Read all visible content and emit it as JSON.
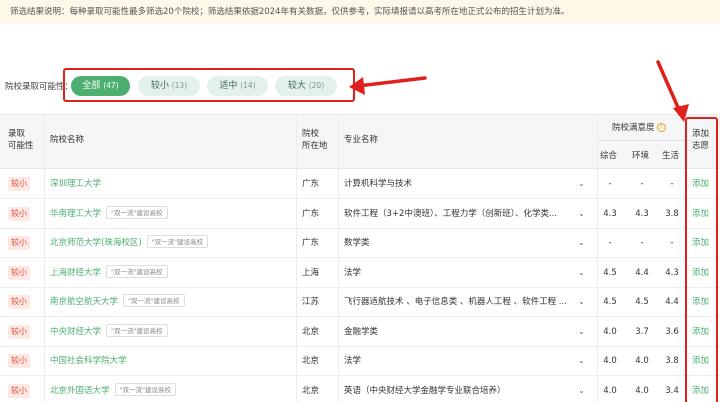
{
  "notice": "筛选结果说明：每种录取可能性最多筛选20个院校；筛选结果依据2024年有关数据，仅供参考，实际填报请以高考所在地正式公布的招生计划为准。",
  "filter": {
    "label": "院校录取可能性：",
    "pills": [
      {
        "label": "全部",
        "count": "(47)"
      },
      {
        "label": "较小",
        "count": "(13)"
      },
      {
        "label": "适中",
        "count": "(14)"
      },
      {
        "label": "较大",
        "count": "(20)"
      }
    ]
  },
  "table": {
    "headers": {
      "possibility_line1": "录取",
      "possibility_line2": "可能性",
      "school": "院校名称",
      "location_line1": "院校",
      "location_line2": "所在地",
      "major": "专业名称",
      "satisfaction": "院校满意度",
      "overall": "综合",
      "environment": "环境",
      "life": "生活",
      "add_line1": "添加",
      "add_line2": "志愿"
    },
    "rows": [
      {
        "possibility": "较小",
        "school": "深圳理工大学",
        "tag": "",
        "location": "广东",
        "major": "计算机科学与技术",
        "overall": "-",
        "environment": "-",
        "life": "-",
        "add": "添加"
      },
      {
        "possibility": "较小",
        "school": "华南理工大学",
        "tag": "\"双一流\"建设高校",
        "location": "广东",
        "major": "软件工程（3+2中澳班）、工程力学（创新班）、化学类...",
        "overall": "4.3",
        "environment": "4.3",
        "life": "3.8",
        "add": "添加"
      },
      {
        "possibility": "较小",
        "school": "北京师范大学(珠海校区)",
        "tag": "\"双一流\"建设高校",
        "location": "广东",
        "major": "数学类",
        "overall": "-",
        "environment": "-",
        "life": "-",
        "add": "添加"
      },
      {
        "possibility": "较小",
        "school": "上海财经大学",
        "tag": "\"双一流\"建设高校",
        "location": "上海",
        "major": "法学",
        "overall": "4.5",
        "environment": "4.4",
        "life": "4.3",
        "add": "添加"
      },
      {
        "possibility": "较小",
        "school": "南京航空航天大学",
        "tag": "\"双一流\"建设高校",
        "location": "江苏",
        "major": "飞行器适航技术 、电子信息类 、机器人工程 、软件工程 ...",
        "overall": "4.5",
        "environment": "4.5",
        "life": "4.4",
        "add": "添加"
      },
      {
        "possibility": "较小",
        "school": "中央财经大学",
        "tag": "\"双一流\"建设高校",
        "location": "北京",
        "major": "金融学类",
        "overall": "4.0",
        "environment": "3.7",
        "life": "3.6",
        "add": "添加"
      },
      {
        "possibility": "较小",
        "school": "中国社会科学院大学",
        "tag": "",
        "location": "北京",
        "major": "法学",
        "overall": "4.0",
        "environment": "4.0",
        "life": "3.8",
        "add": "添加"
      },
      {
        "possibility": "较小",
        "school": "北京外国语大学",
        "tag": "\"双一流\"建设高校",
        "location": "北京",
        "major": "英语（中央财经大学金融学专业联合培养）",
        "overall": "4.0",
        "environment": "4.0",
        "life": "3.4",
        "add": "添加"
      }
    ]
  },
  "colors": {
    "accent_green": "#4caf70",
    "highlight_red": "#e0201b",
    "badge_red": "#e04a3a"
  }
}
